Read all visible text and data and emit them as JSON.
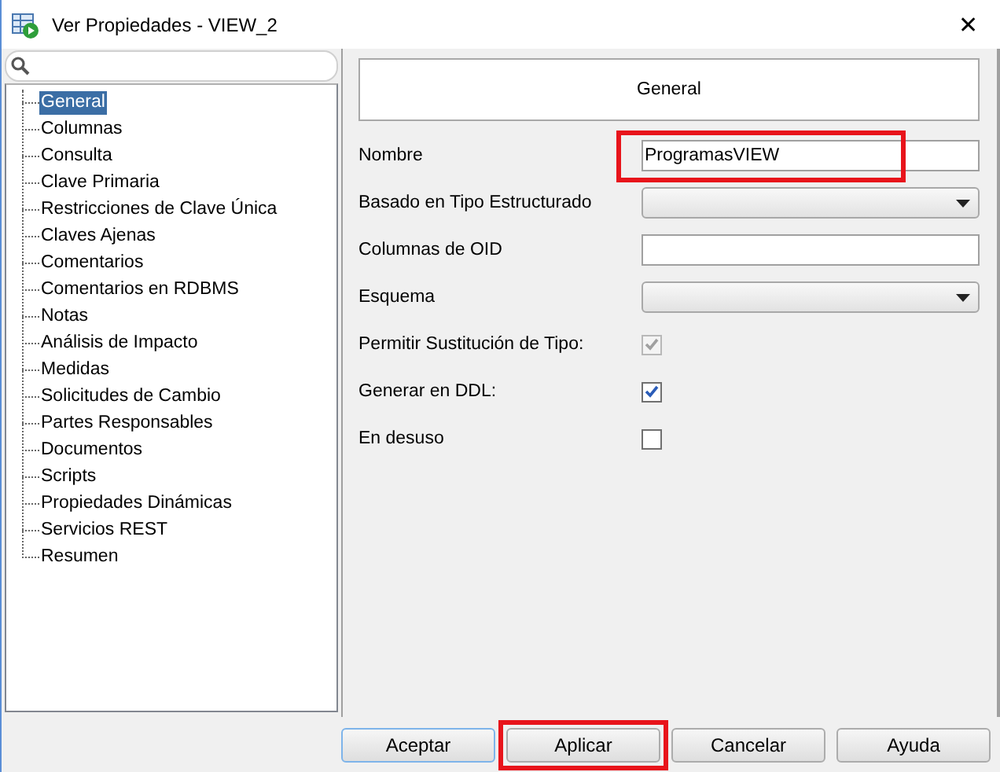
{
  "window": {
    "title": "Ver Propiedades - VIEW_2",
    "close": "✕"
  },
  "sidebar": {
    "items": [
      {
        "label": "General",
        "selected": true
      },
      {
        "label": "Columnas",
        "selected": false
      },
      {
        "label": "Consulta",
        "selected": false
      },
      {
        "label": "Clave Primaria",
        "selected": false
      },
      {
        "label": "Restricciones de Clave Única",
        "selected": false
      },
      {
        "label": "Claves Ajenas",
        "selected": false
      },
      {
        "label": "Comentarios",
        "selected": false
      },
      {
        "label": "Comentarios en RDBMS",
        "selected": false
      },
      {
        "label": "Notas",
        "selected": false
      },
      {
        "label": "Análisis de Impacto",
        "selected": false
      },
      {
        "label": "Medidas",
        "selected": false
      },
      {
        "label": "Solicitudes de Cambio",
        "selected": false
      },
      {
        "label": "Partes Responsables",
        "selected": false
      },
      {
        "label": "Documentos",
        "selected": false
      },
      {
        "label": "Scripts",
        "selected": false
      },
      {
        "label": "Propiedades Dinámicas",
        "selected": false
      },
      {
        "label": "Servicios REST",
        "selected": false
      },
      {
        "label": "Resumen",
        "selected": false
      }
    ]
  },
  "panel": {
    "heading": "General",
    "fields": [
      {
        "kind": "text",
        "label": "Nombre",
        "value": "ProgramasVIEW",
        "highlighted": true
      },
      {
        "kind": "dropdown",
        "label": "Basado en Tipo Estructurado"
      },
      {
        "kind": "text",
        "label": "Columnas de OID"
      },
      {
        "kind": "dropdown",
        "label": "Esquema"
      },
      {
        "kind": "checkbox",
        "label": "Permitir Sustitución de Tipo:",
        "checked": true,
        "disabled": true
      },
      {
        "kind": "checkbox",
        "label": "Generar en DDL:",
        "checked": true,
        "disabled": false
      },
      {
        "kind": "checkbox",
        "label": "En desuso",
        "checked": false,
        "disabled": false
      }
    ]
  },
  "buttons": [
    {
      "label": "Aceptar",
      "highlighted": false
    },
    {
      "label": "Aplicar",
      "highlighted": true
    },
    {
      "label": "Cancelar",
      "highlighted": false
    },
    {
      "label": "Ayuda",
      "highlighted": false
    }
  ]
}
